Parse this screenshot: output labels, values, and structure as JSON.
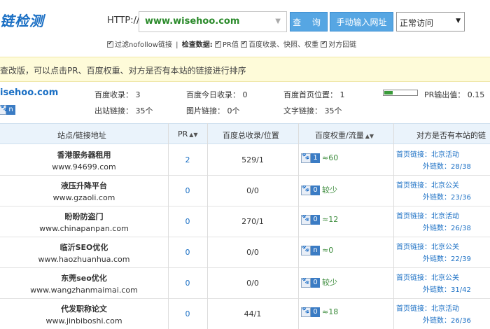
{
  "header": {
    "logo": "链检测",
    "http_label": "HTTP://",
    "url_value": "www.wisehoo.com",
    "query_btn": "查 询",
    "manual_btn": "手动输入网址",
    "mode_value": "正常访问"
  },
  "options": {
    "filter_nofollow": "过滤nofollow链接",
    "check_label": "检查数据:",
    "pr": "PR值",
    "baidu": "百度收录、快照、权重",
    "backlink": "对方回链"
  },
  "notice": "查改版，可以点击PR、百度权重、对方是否有本站的链接进行排序",
  "summary": {
    "site": "isehoo.com",
    "baidu_index": "百度收录： 3",
    "baidu_today": "百度今日收录： 0",
    "baidu_home_pos": "百度首页位置： 1",
    "pr_output": "PR输出值： 0.15",
    "out_links": "出站链接： 35个",
    "img_links": "图片链接： 0个",
    "text_links": "文字链接： 35个",
    "baidu_weight_small": "n"
  },
  "table": {
    "headers": {
      "site": "站点/链接地址",
      "pr": "PR",
      "index": "百度总收录/位置",
      "weight": "百度权重/流量",
      "backlink": "对方是否有本站的链"
    },
    "rows": [
      {
        "title": "香港服务器租用",
        "url": "www.94699.com",
        "pr": "2",
        "index": "529/1",
        "weight": "1",
        "traffic": "≈60",
        "link1": "首页链接：北京活动",
        "link2": "外链数：28/38"
      },
      {
        "title": "液压升降平台",
        "url": "www.gzaoli.com",
        "pr": "0",
        "index": "0/0",
        "weight": "0",
        "traffic": "较少",
        "link1": "首页链接：北京公关",
        "link2": "外链数：23/36"
      },
      {
        "title": "盼盼防盗门",
        "url": "www.chinapanpan.com",
        "pr": "0",
        "index": "270/1",
        "weight": "0",
        "traffic": "≈12",
        "link1": "首页链接：北京活动",
        "link2": "外链数：26/38"
      },
      {
        "title": "临沂SEO优化",
        "url": "www.haozhuanhua.com",
        "pr": "0",
        "index": "0/0",
        "weight": "n",
        "traffic": "≈0",
        "link1": "首页链接：北京公关",
        "link2": "外链数：22/39"
      },
      {
        "title": "东莞seo优化",
        "url": "www.wangzhanmaimai.com",
        "pr": "0",
        "index": "0/0",
        "weight": "0",
        "traffic": "较少",
        "link1": "首页链接：北京公关",
        "link2": "外链数：31/42"
      },
      {
        "title": "代发职称论文",
        "url": "www.jinbiboshi.com",
        "pr": "0",
        "index": "44/1",
        "weight": "0",
        "traffic": "≈18",
        "link1": "首页链接：北京活动",
        "link2": "外链数：26/36"
      }
    ]
  }
}
